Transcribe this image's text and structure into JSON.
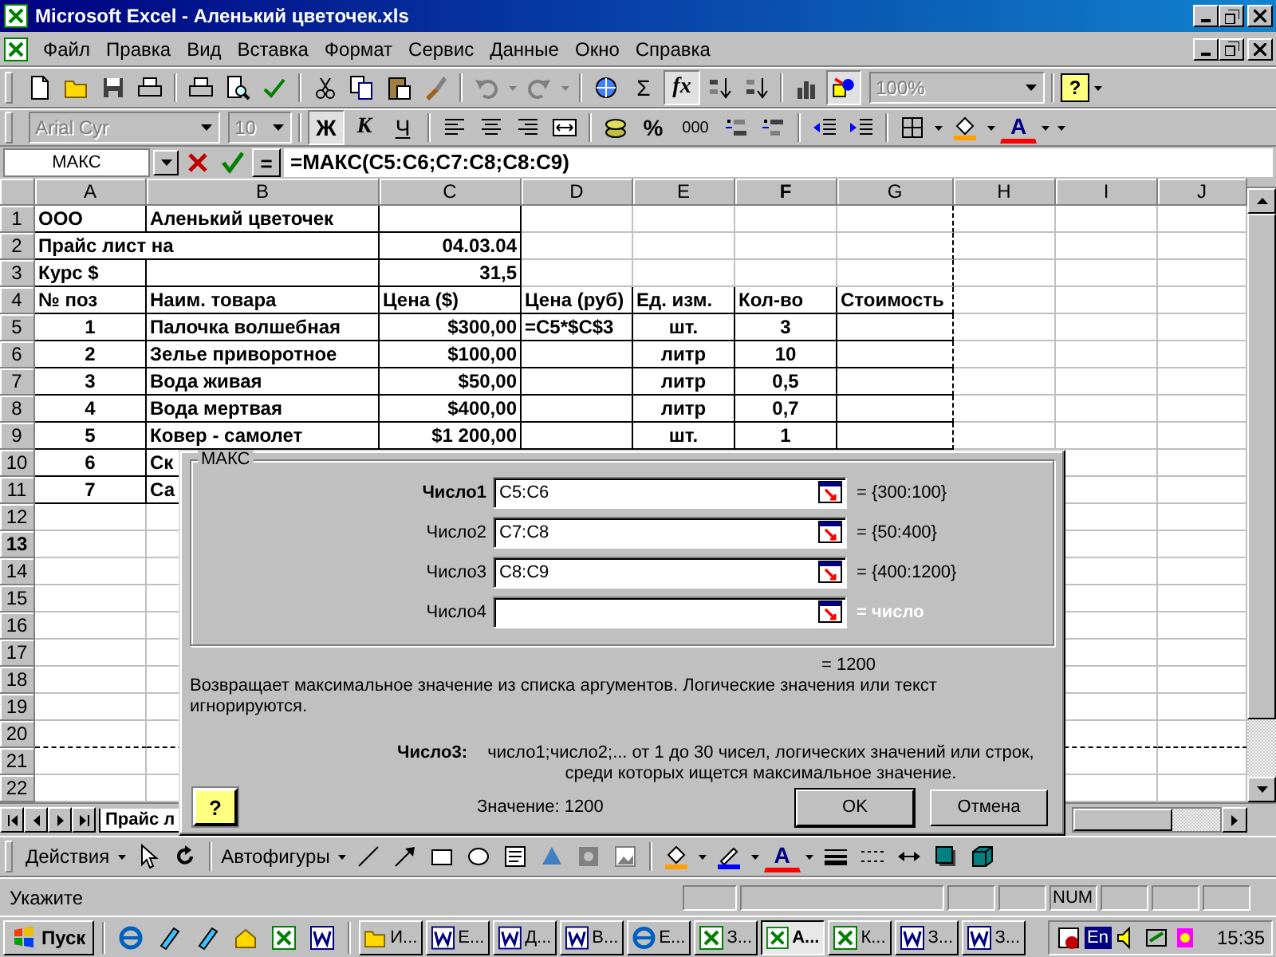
{
  "window": {
    "title": "Microsoft Excel - Аленький цветочек.xls"
  },
  "menu": [
    "Файл",
    "Правка",
    "Вид",
    "Вставка",
    "Формат",
    "Сервис",
    "Данные",
    "Окно",
    "Справка"
  ],
  "standard_toolbar": {
    "sum": "Σ",
    "function": {
      "label": "fx",
      "pressed": true
    },
    "drawing_pressed": true,
    "zoom": "100%",
    "help": "?"
  },
  "formatting_toolbar": {
    "font": "Arial Cyr",
    "size": "10",
    "bold": {
      "label": "Ж",
      "pressed": true
    },
    "italic": {
      "label": "К",
      "pressed": false
    },
    "underline": {
      "label": "Ч",
      "pressed": false
    },
    "percent": "%",
    "thousands": "000",
    "font_color": "A"
  },
  "formula_bar": {
    "name_box": "МАКС",
    "equals": "=",
    "formula": "=МАКС(C5:C6;C7:C8;C8:C9)"
  },
  "sheet": {
    "columns": [
      {
        "label": "A",
        "selected": false
      },
      {
        "label": "B",
        "selected": false
      },
      {
        "label": "C",
        "selected": false
      },
      {
        "label": "D",
        "selected": false
      },
      {
        "label": "E",
        "selected": false
      },
      {
        "label": "F",
        "selected": true
      },
      {
        "label": "G",
        "selected": false
      },
      {
        "label": "H",
        "selected": false
      },
      {
        "label": "I",
        "selected": false
      },
      {
        "label": "J",
        "selected": false
      }
    ],
    "rows": [
      {
        "label": "1",
        "selected": false,
        "cells": {
          "A": "ООО",
          "B": "Аленький цветочек"
        }
      },
      {
        "label": "2",
        "selected": false,
        "cells": {
          "A": "Прайс лист на",
          "C": "04.03.04"
        }
      },
      {
        "label": "3",
        "selected": false,
        "cells": {
          "A": "Курс $",
          "C": "31,5"
        }
      },
      {
        "label": "4",
        "selected": false,
        "cells": {
          "A": "№ поз",
          "B": "Наим. товара",
          "C": "Цена ($)",
          "D": "Цена (руб)",
          "E": "Ед. изм.",
          "F": "Кол-во",
          "G": "Стоимость"
        }
      },
      {
        "label": "5",
        "selected": false,
        "cells": {
          "A": "1",
          "B": "Палочка волшебная",
          "C": "$300,00",
          "D": "=C5*$C$3",
          "E": "шт.",
          "F": "3"
        }
      },
      {
        "label": "6",
        "selected": false,
        "cells": {
          "A": "2",
          "B": "Зелье приворотное",
          "C": "$100,00",
          "E": "литр",
          "F": "10"
        }
      },
      {
        "label": "7",
        "selected": false,
        "cells": {
          "A": "3",
          "B": "Вода живая",
          "C": "$50,00",
          "E": "литр",
          "F": "0,5"
        }
      },
      {
        "label": "8",
        "selected": false,
        "cells": {
          "A": "4",
          "B": "Вода мертвая",
          "C": "$400,00",
          "E": "литр",
          "F": "0,7"
        }
      },
      {
        "label": "9",
        "selected": false,
        "cells": {
          "A": "5",
          "B": "Ковер - самолет",
          "C": "$1 200,00",
          "E": "шт.",
          "F": "1"
        }
      },
      {
        "label": "10",
        "selected": false,
        "cells": {
          "A": "6",
          "B": "Ск"
        }
      },
      {
        "label": "11",
        "selected": false,
        "cells": {
          "A": "7",
          "B": "Са"
        }
      },
      {
        "label": "12",
        "selected": false
      },
      {
        "label": "13",
        "selected": true
      },
      {
        "label": "14",
        "selected": false
      },
      {
        "label": "15",
        "selected": false
      },
      {
        "label": "16",
        "selected": false
      },
      {
        "label": "17",
        "selected": false
      },
      {
        "label": "18",
        "selected": false
      },
      {
        "label": "19",
        "selected": false
      },
      {
        "label": "20",
        "selected": false
      },
      {
        "label": "21",
        "selected": false
      },
      {
        "label": "22",
        "selected": false
      }
    ]
  },
  "sheet_tabs": [
    {
      "label": "Прайс л",
      "selected": true
    }
  ],
  "dialog": {
    "group_title": "МАКС",
    "arguments": [
      {
        "label": "Число1",
        "value": "C5:C6",
        "result": "= {300:100}",
        "selected": true,
        "dimmed": false
      },
      {
        "label": "Число2",
        "value": "C7:C8",
        "result": "= {50:400}",
        "selected": false,
        "dimmed": false
      },
      {
        "label": "Число3",
        "value": "C8:C9",
        "result": "= {400:1200}",
        "selected": false,
        "dimmed": false
      },
      {
        "label": "Число4",
        "result": "= число",
        "selected": false,
        "dimmed": true
      }
    ],
    "result": "= 1200",
    "description": "Возвращает максимальное значение из списка аргументов. Логические значения или текст игнорируются.",
    "argument_name": "Число3:",
    "argument_help": "число1;число2;... от 1 до 30 чисел, логических значений или строк, среди которых ищется максимальное значение.",
    "help": "?",
    "value": "Значение: 1200",
    "buttons": [
      "OK",
      "Отмена"
    ]
  },
  "drawing_toolbar": {
    "actions": "Действия",
    "autoshapes": "Автофигуры",
    "font_color": "A"
  },
  "status_bar": {
    "message": "Укажите",
    "num": "NUM"
  },
  "taskbar": {
    "start": "Пуск",
    "tasks": [
      {
        "label": "И...",
        "kind": "folder",
        "selected": false
      },
      {
        "label": "Е...",
        "kind": "word",
        "selected": false
      },
      {
        "label": "Д...",
        "kind": "word",
        "selected": false
      },
      {
        "label": "В...",
        "kind": "word",
        "selected": false
      },
      {
        "label": "Е...",
        "kind": "browser",
        "selected": false
      },
      {
        "label": "З...",
        "kind": "excel",
        "selected": false
      },
      {
        "label": "А...",
        "kind": "excel",
        "selected": true
      },
      {
        "label": "К...",
        "kind": "excel",
        "selected": false
      },
      {
        "label": "З...",
        "kind": "word",
        "selected": false
      },
      {
        "label": "З...",
        "kind": "word",
        "selected": false
      }
    ],
    "language": "En",
    "clock": "15:35"
  }
}
